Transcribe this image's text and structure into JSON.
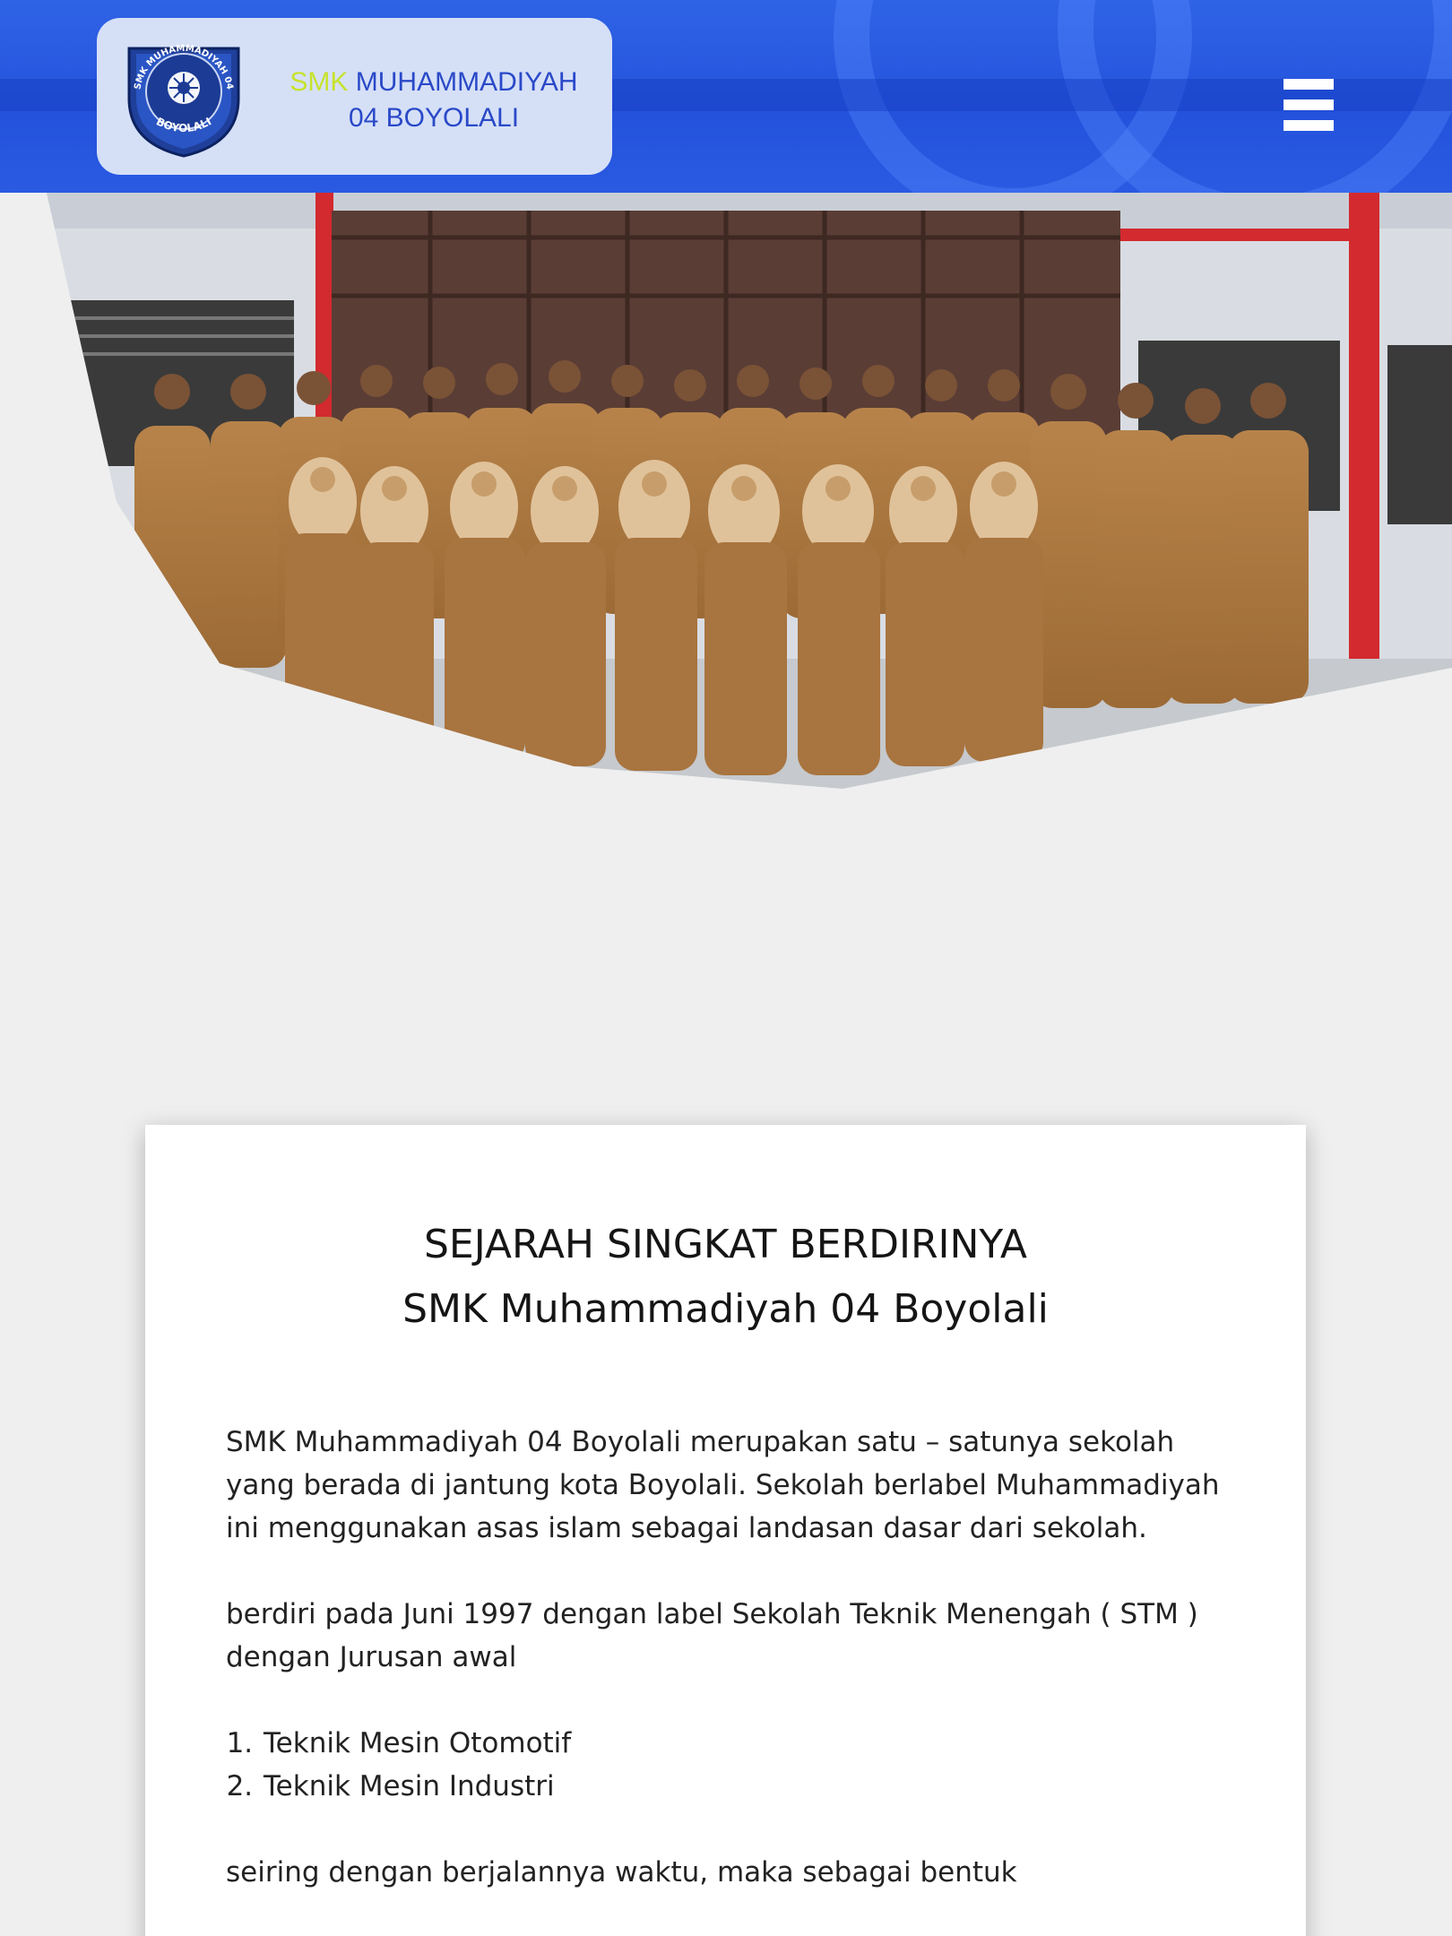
{
  "header": {
    "logo_prefix": "SMK",
    "logo_name_line1": "MUHAMMADIYAH",
    "logo_name_line2": "04 BOYOLALI",
    "seal_text_top": "SMK MUHAMMADIYAH 04",
    "seal_text_bottom": "BOYOLALI",
    "menu_icon": "hamburger-menu-icon"
  },
  "hero": {
    "image": "group-photo-of-school-staff"
  },
  "article": {
    "title_line1": "SEJARAH SINGKAT BERDIRINYA",
    "title_line2": "SMK Muhammadiyah 04 Boyolali",
    "paragraph1": "SMK Muhammadiyah 04 Boyolali merupakan satu – satunya sekolah yang berada di jantung kota Boyolali. Sekolah berlabel Muhammadiyah ini menggunakan asas islam sebagai landasan dasar dari sekolah.",
    "paragraph2": "berdiri pada Juni 1997 dengan label Sekolah Teknik Menengah ( STM ) dengan Jurusan awal",
    "departments": [
      "Teknik Mesin Otomotif",
      "Teknik Mesin Industri"
    ],
    "paragraph3": "seiring dengan berjalannya waktu, maka sebagai bentuk"
  },
  "colors": {
    "header_blue": "#2452dc",
    "logo_box": "#d5e0f7",
    "logo_accent": "#c7e22d",
    "logo_text": "#2a49c8",
    "page_bg": "#efefef"
  }
}
